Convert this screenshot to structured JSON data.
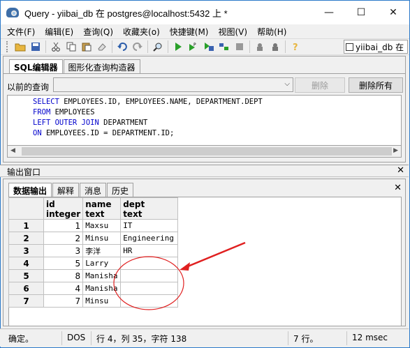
{
  "window": {
    "title": "Query - yiibai_db 在  postgres@localhost:5432 上 *",
    "minimize": "—",
    "maximize": "☐",
    "close": "✕"
  },
  "menu": [
    "文件(F)",
    "编辑(E)",
    "查询(Q)",
    "收藏夹(o)",
    "快捷键(M)",
    "视图(V)",
    "帮助(H)"
  ],
  "toolbar": {
    "db_selector": "yiibai_db 在"
  },
  "editor": {
    "tabs": [
      "SQL编辑器",
      "图形化查询构造器"
    ],
    "previous_query_label": "以前的查询",
    "delete_button": "删除",
    "delete_all_button": "删除所有",
    "sql_lines": [
      {
        "kw": "SELECT",
        "rest": " EMPLOYEES.ID, EMPLOYEES.NAME, DEPARTMENT.DEPT"
      },
      {
        "kw": "FROM",
        "rest": " EMPLOYEES"
      },
      {
        "kw": "LEFT OUTER JOIN",
        "rest": " DEPARTMENT"
      },
      {
        "kw": "ON",
        "rest": " EMPLOYEES.ID = DEPARTMENT.ID;"
      }
    ]
  },
  "output": {
    "pane_title": "输出窗口",
    "tabs": [
      "数据输出",
      "解释",
      "消息",
      "历史"
    ],
    "columns": [
      {
        "name": "id",
        "type": "integer"
      },
      {
        "name": "name",
        "type": "text"
      },
      {
        "name": "dept",
        "type": "text"
      }
    ],
    "rows": [
      {
        "n": "1",
        "id": "1",
        "name": "Maxsu",
        "dept": "IT"
      },
      {
        "n": "2",
        "id": "2",
        "name": "Minsu",
        "dept": "Engineering"
      },
      {
        "n": "3",
        "id": "3",
        "name": "李洋",
        "dept": "HR"
      },
      {
        "n": "4",
        "id": "5",
        "name": "Larry",
        "dept": ""
      },
      {
        "n": "5",
        "id": "8",
        "name": "Manisha",
        "dept": ""
      },
      {
        "n": "6",
        "id": "4",
        "name": "Manisha",
        "dept": ""
      },
      {
        "n": "7",
        "id": "7",
        "name": "Minsu",
        "dept": ""
      }
    ]
  },
  "status": {
    "state": "确定。",
    "encoding": "DOS",
    "position": "行 4，列 35，字符 138",
    "rows": "7 行。",
    "time": "12 msec"
  },
  "colors": {
    "keyword": "#0000cc",
    "annotation": "#e02020",
    "window_border": "#2b79c9"
  }
}
